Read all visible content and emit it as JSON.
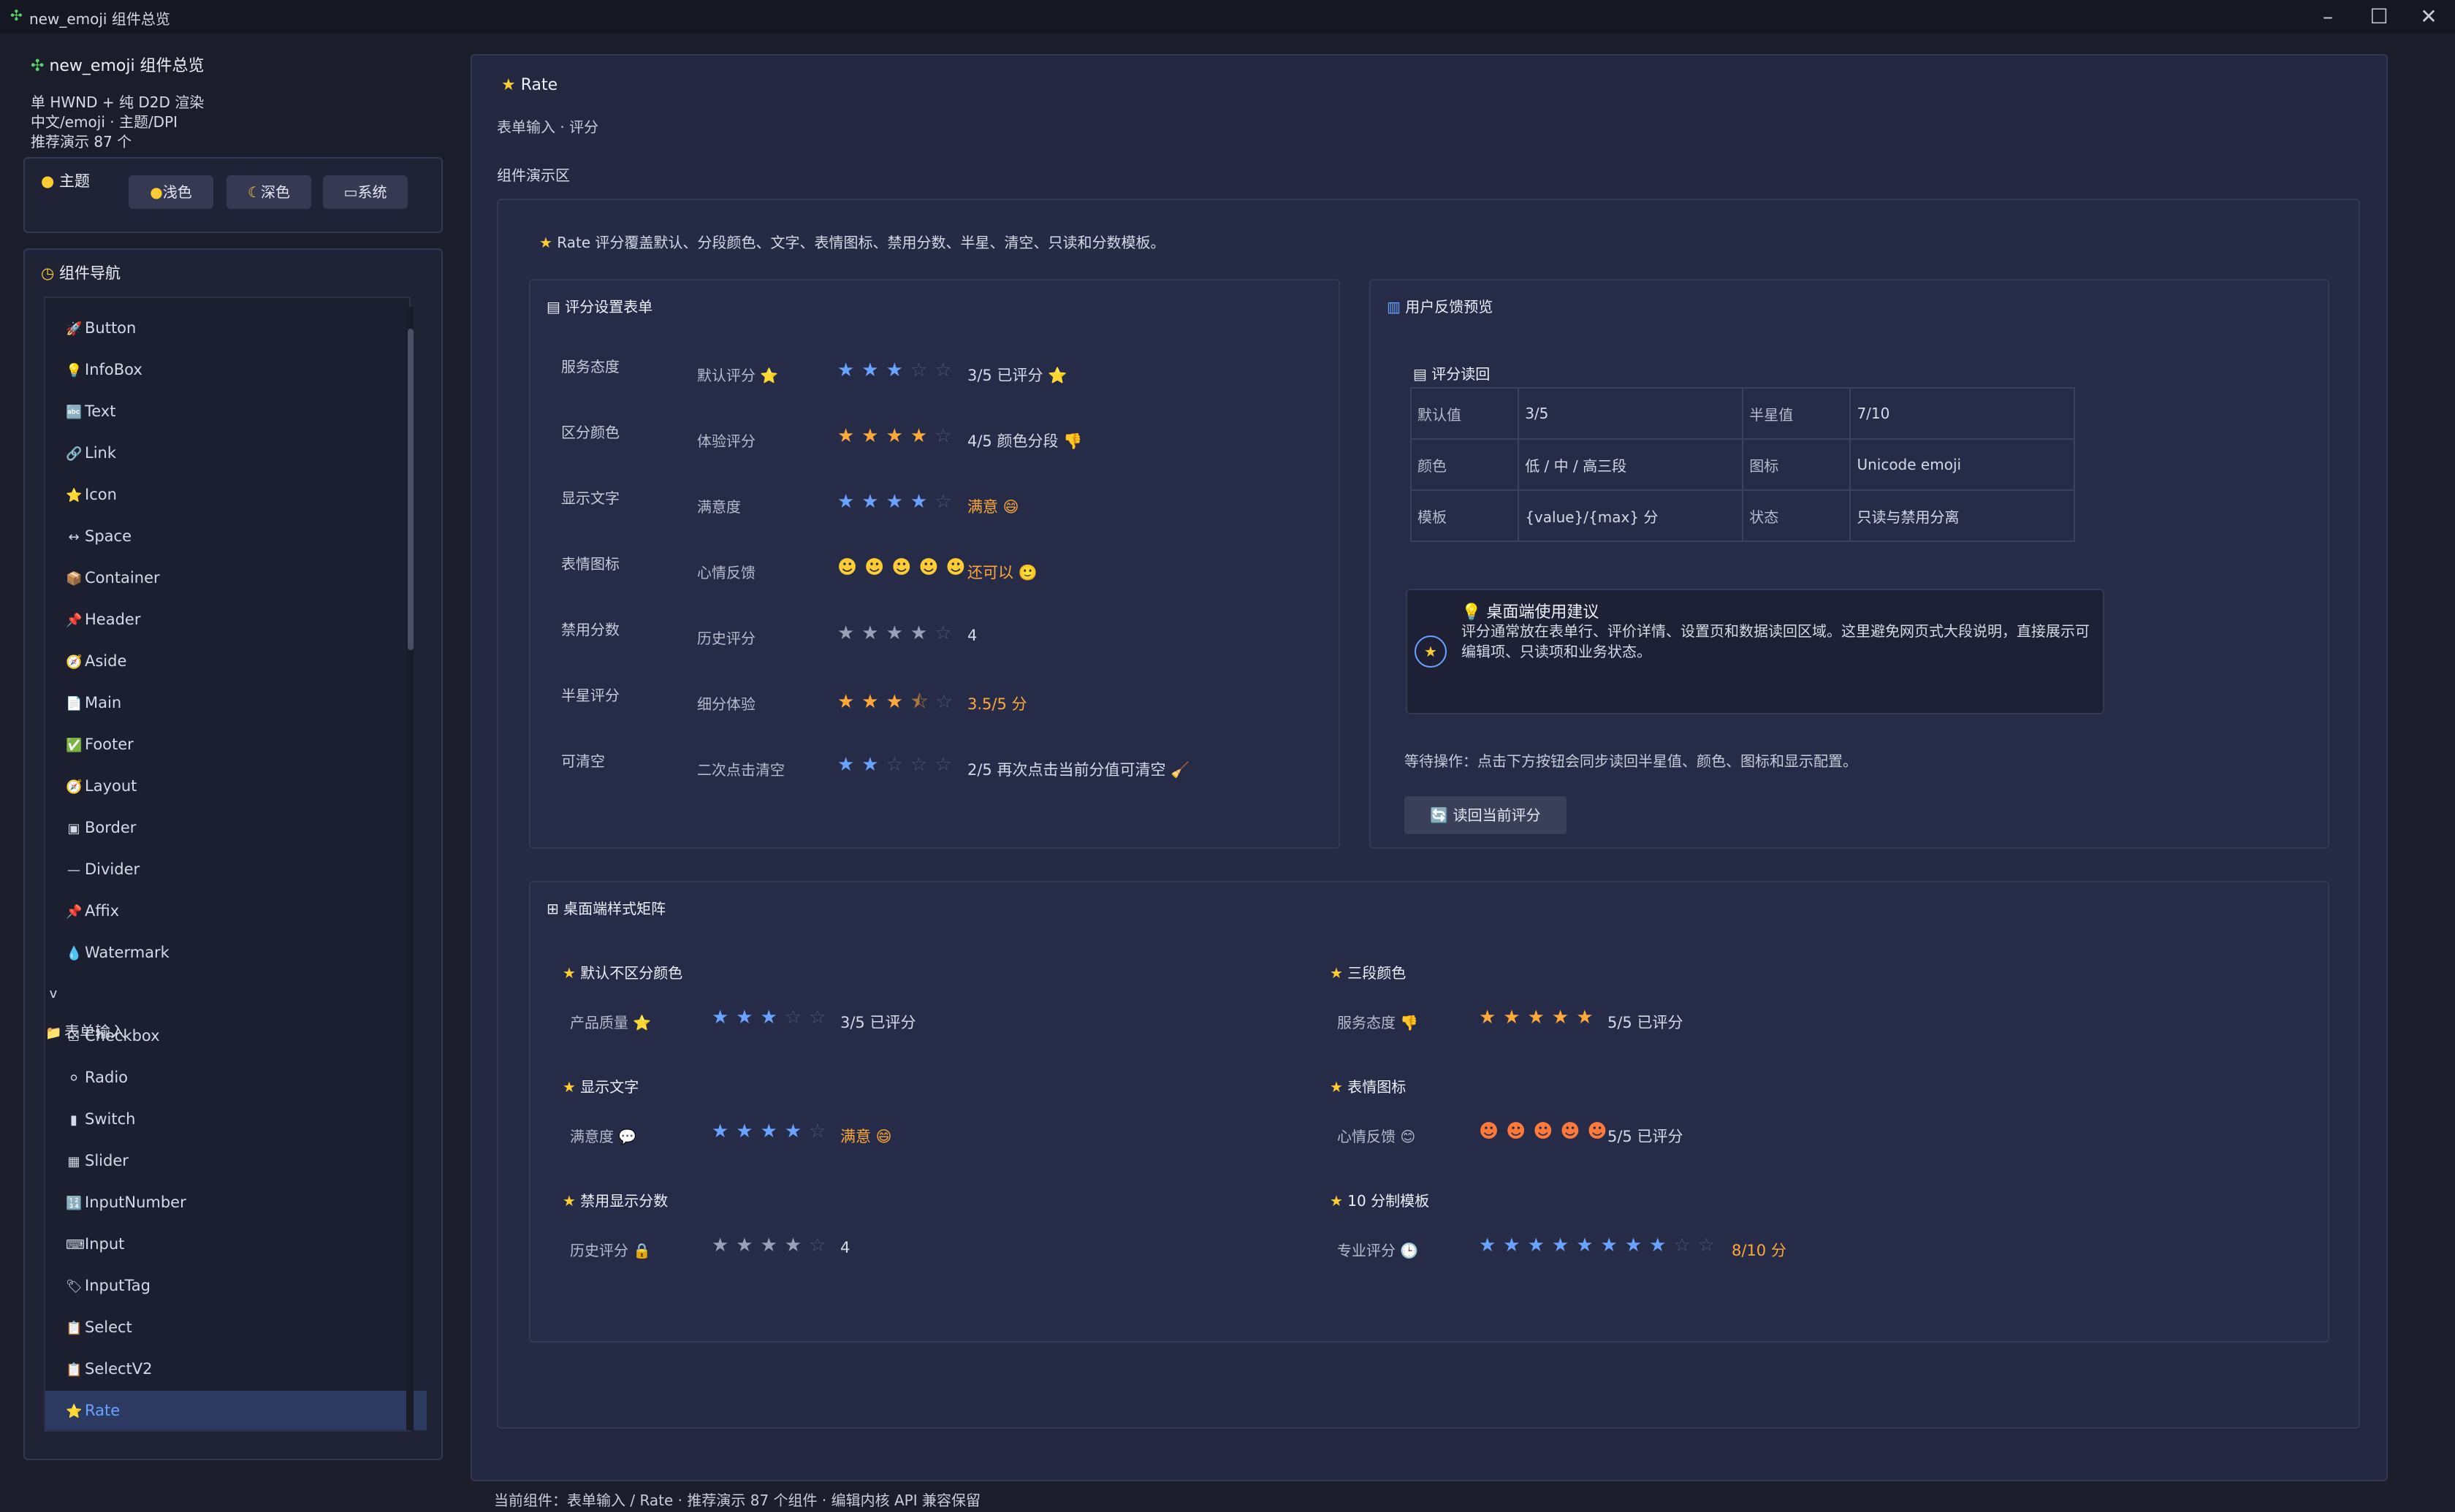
{
  "window": {
    "title": "new_emoji 组件总览",
    "app_icon": "puzzle-icon"
  },
  "sidebar": {
    "header": "new_emoji 组件总览",
    "info": [
      "单 HWND + 纯 D2D 渲染",
      "中文/emoji · 主题/DPI",
      "推荐演示 87 个"
    ],
    "theme": {
      "label": "主题",
      "buttons": [
        "浅色",
        "深色",
        "系统"
      ]
    },
    "nav": {
      "title": "组件导航",
      "items": [
        {
          "icon": "🚀",
          "label": "Button"
        },
        {
          "icon": "💡",
          "label": "InfoBox"
        },
        {
          "icon": "🔤",
          "label": "Text"
        },
        {
          "icon": "🔗",
          "label": "Link"
        },
        {
          "icon": "⭐",
          "label": "Icon"
        },
        {
          "icon": "↔",
          "label": "Space"
        },
        {
          "icon": "📦",
          "label": "Container"
        },
        {
          "icon": "📌",
          "label": "Header"
        },
        {
          "icon": "🧭",
          "label": "Aside"
        },
        {
          "icon": "📄",
          "label": "Main"
        },
        {
          "icon": "✅",
          "label": "Footer"
        },
        {
          "icon": "🧭",
          "label": "Layout"
        },
        {
          "icon": "▣",
          "label": "Border"
        },
        {
          "icon": "—",
          "label": "Divider"
        },
        {
          "icon": "📌",
          "label": "Affix"
        },
        {
          "icon": "💧",
          "label": "Watermark"
        },
        {
          "icon": "v📁",
          "label": "表单输入"
        },
        {
          "icon": "☑",
          "label": "Checkbox"
        },
        {
          "icon": "⚪",
          "label": "Radio"
        },
        {
          "icon": "▮",
          "label": "Switch"
        },
        {
          "icon": "▦",
          "label": "Slider"
        },
        {
          "icon": "🔢",
          "label": "InputNumber"
        },
        {
          "icon": "⌨",
          "label": "Input"
        },
        {
          "icon": "🏷",
          "label": "InputTag"
        },
        {
          "icon": "📋",
          "label": "Select"
        },
        {
          "icon": "📋",
          "label": "SelectV2"
        },
        {
          "icon": "⭐",
          "label": "Rate"
        }
      ]
    }
  },
  "main": {
    "title": "Rate",
    "subtitle": "表单输入 · 评分",
    "demo_title": "组件演示区",
    "description": "Rate 评分覆盖默认、分段颜色、文字、表情图标、禁用分数、半星、清空、只读和分数模板。",
    "form_card": {
      "title": "评分设置表单",
      "rows": [
        {
          "label": "服务态度",
          "sub": "默认评分 ⭐",
          "value": "3/5 已评分 ⭐"
        },
        {
          "label": "区分颜色",
          "sub": "体验评分",
          "value": "4/5 颜色分段 👎"
        },
        {
          "label": "显示文字",
          "sub": "满意度",
          "value": "满意 😄"
        },
        {
          "label": "表情图标",
          "sub": "心情反馈",
          "value": "还可以 🙂"
        },
        {
          "label": "禁用分数",
          "sub": "历史评分",
          "value": "4"
        },
        {
          "label": "半星评分",
          "sub": "细分体验",
          "value": "3.5/5 分"
        },
        {
          "label": "可清空",
          "sub": "二次点击清空",
          "value": "2/5 再次点击当前分值可清空 🧹"
        }
      ]
    },
    "feedback_card": {
      "title": "用户反馈预览",
      "readback_title": "评分读回",
      "table": [
        [
          "默认值",
          "3/5",
          "半星值",
          "7/10"
        ],
        [
          "颜色",
          "低 / 中 / 高三段",
          "图标",
          "Unicode emoji"
        ],
        [
          "模板",
          "{value}/{max} 分",
          "状态",
          "只读与禁用分离"
        ]
      ],
      "tip_title": "💡 桌面端使用建议",
      "tip_text": "评分通常放在表单行、评价详情、设置页和数据读回区域。这里避免网页式大段说明，直接展示可编辑项、只读项和业务状态。",
      "wait_text": "等待操作：点击下方按钮会同步读回半星值、颜色、图标和显示配置。",
      "read_button": "🔄 读回当前评分"
    },
    "matrix": {
      "title": "桌面端样式矩阵",
      "items": [
        {
          "title": "默认不区分颜色",
          "label": "产品质量 ⭐",
          "value": "3/5 已评分"
        },
        {
          "title": "三段颜色",
          "label": "服务态度 👎",
          "value": "5/5 已评分"
        },
        {
          "title": "显示文字",
          "label": "满意度 💬",
          "value": "满意 😄"
        },
        {
          "title": "表情图标",
          "label": "心情反馈 😊",
          "value": "5/5 已评分"
        },
        {
          "title": "禁用显示分数",
          "label": "历史评分 🔒",
          "value": "4"
        },
        {
          "title": "10 分制模板",
          "label": "专业评分 🕒",
          "value": "8/10 分"
        }
      ]
    }
  },
  "status_bar": "当前组件：表单输入 / Rate · 推荐演示 87 个组件 · 编辑内核 API 兼容保留",
  "colors": {
    "accent": "#6aa3ff",
    "star_orange": "#ffa83a",
    "background": "#1b1d2b"
  }
}
